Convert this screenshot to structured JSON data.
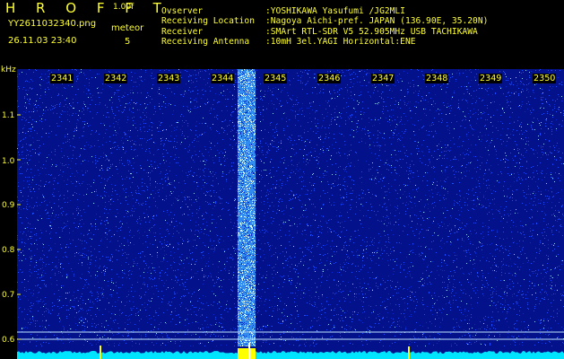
{
  "header": {
    "app_title": "H R O F F T",
    "version": "1.00f",
    "file_name": "YY2611032340.png",
    "meteor_label": "meteor",
    "meteor_count": "5",
    "date_time": "26.11.03 23:40"
  },
  "info": [
    {
      "key": "Ovserver",
      "value": ":YOSHIKAWA Yasufumi /JG2MLI"
    },
    {
      "key": "Receiving Location",
      "value": ":Nagoya Aichi-pref. JAPAN (136.90E, 35.20N)"
    },
    {
      "key": "Receiver",
      "value": ":SMArt RTL-SDR V5 52.905MHz USB TACHIKAWA"
    },
    {
      "key": "Receiving Antenna",
      "value": ":10mH 3el.YAGI Horizontal:ENE"
    }
  ],
  "chart_data": {
    "type": "heatmap",
    "ylabel": "kHz",
    "y_ticks": [
      "1.1",
      "1.0",
      "0.9",
      "0.8",
      "0.7",
      "0.6"
    ],
    "x_ticks": [
      "2341",
      "2342",
      "2343",
      "2344",
      "2345",
      "2346",
      "2347",
      "2348",
      "2349",
      "2350"
    ]
  },
  "colors": {
    "text": "#ffff33",
    "background": "#000000",
    "noise_base": "#03128a",
    "signal": "#3aa0ff",
    "spectrum": "#00e5ff",
    "marker": "#ffff00"
  }
}
